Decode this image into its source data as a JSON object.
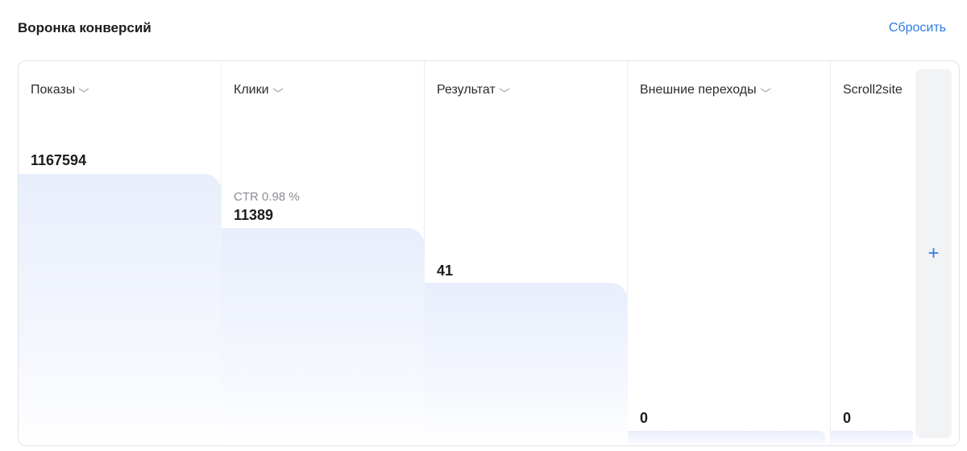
{
  "header": {
    "title": "Воронка конверсий",
    "reset_label": "Сбросить"
  },
  "funnel": {
    "columns": [
      {
        "label": "Показы",
        "value": "1167594",
        "sub": ""
      },
      {
        "label": "Клики",
        "value": "11389",
        "sub": "CTR 0.98 %"
      },
      {
        "label": "Результат",
        "value": "41",
        "sub": ""
      },
      {
        "label": "Внешние переходы",
        "value": "0",
        "sub": ""
      },
      {
        "label": "Scroll2site",
        "value": "0",
        "sub": ""
      }
    ],
    "add_label": "+"
  },
  "colors": {
    "accent": "#2f7ae5",
    "bar_fill": "#e8eefb",
    "panel_bg": "#f2f3f5"
  },
  "icons": {
    "column_dropdown": "chevron-down-icon",
    "add": "plus-icon"
  }
}
